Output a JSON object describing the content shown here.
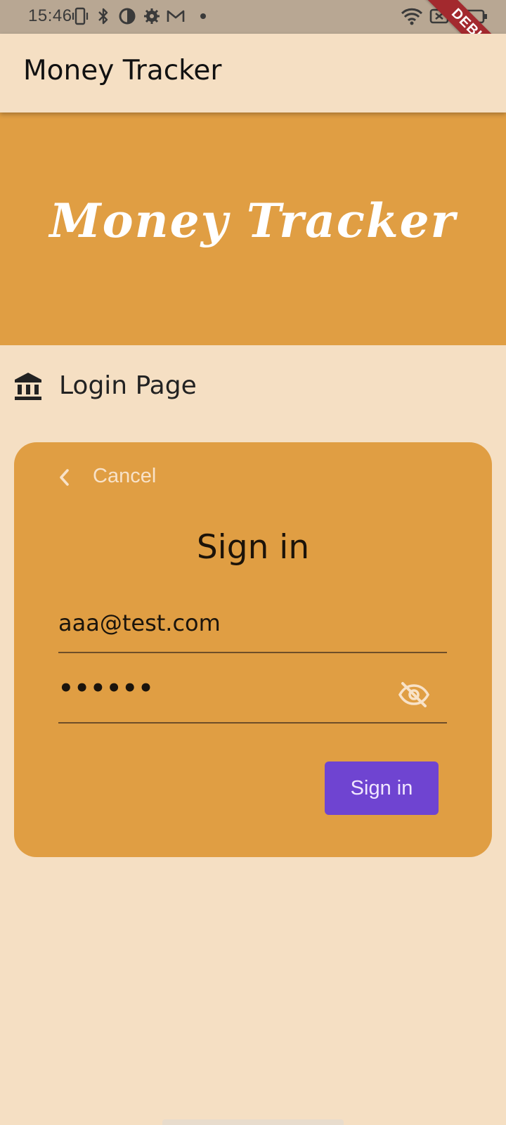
{
  "status_bar": {
    "time": "15:46",
    "icons": [
      "vibrate-icon",
      "bluetooth-icon",
      "data-saver-icon",
      "settings-icon",
      "gmail-icon",
      "dot-icon",
      "wifi-icon",
      "no-sim-icon",
      "battery-icon"
    ]
  },
  "debug_banner": "DEBUG",
  "app_bar": {
    "title": "Money Tracker"
  },
  "hero": {
    "title": "Money Tracker",
    "background": "#e09e43"
  },
  "login_row": {
    "icon": "bank-icon",
    "label": "Login Page"
  },
  "card": {
    "cancel": {
      "icon": "chevron-left-icon",
      "label": "Cancel"
    },
    "title": "Sign in",
    "email": {
      "value": "aaa@test.com"
    },
    "password": {
      "value": "••••••",
      "toggle_icon": "eye-off-icon"
    },
    "submit": {
      "label": "Sign in",
      "color": "#6f44d1"
    }
  },
  "colors": {
    "background": "#f5dfc3",
    "accent": "#e09e43",
    "status_bar": "#b8a793"
  }
}
